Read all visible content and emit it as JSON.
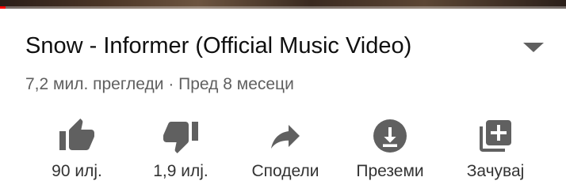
{
  "player": {
    "progress_fraction": 0.01
  },
  "video": {
    "title": "Snow - Informer (Official Music Video)",
    "meta": "7,2 мил. прегледи · Пред 8 месеци"
  },
  "actions": [
    {
      "id": "like",
      "label": "90 илј.",
      "icon": "thumb-up-icon"
    },
    {
      "id": "dislike",
      "label": "1,9 илј.",
      "icon": "thumb-down-icon"
    },
    {
      "id": "share",
      "label": "Сподели",
      "icon": "share-icon"
    },
    {
      "id": "download",
      "label": "Преземи",
      "icon": "download-icon"
    },
    {
      "id": "save",
      "label": "Зачувај",
      "icon": "playlist-add-icon"
    }
  ],
  "colors": {
    "icon": "#606060",
    "text_primary": "#0f0f0f",
    "text_secondary": "#606060",
    "accent": "#ff0000"
  }
}
